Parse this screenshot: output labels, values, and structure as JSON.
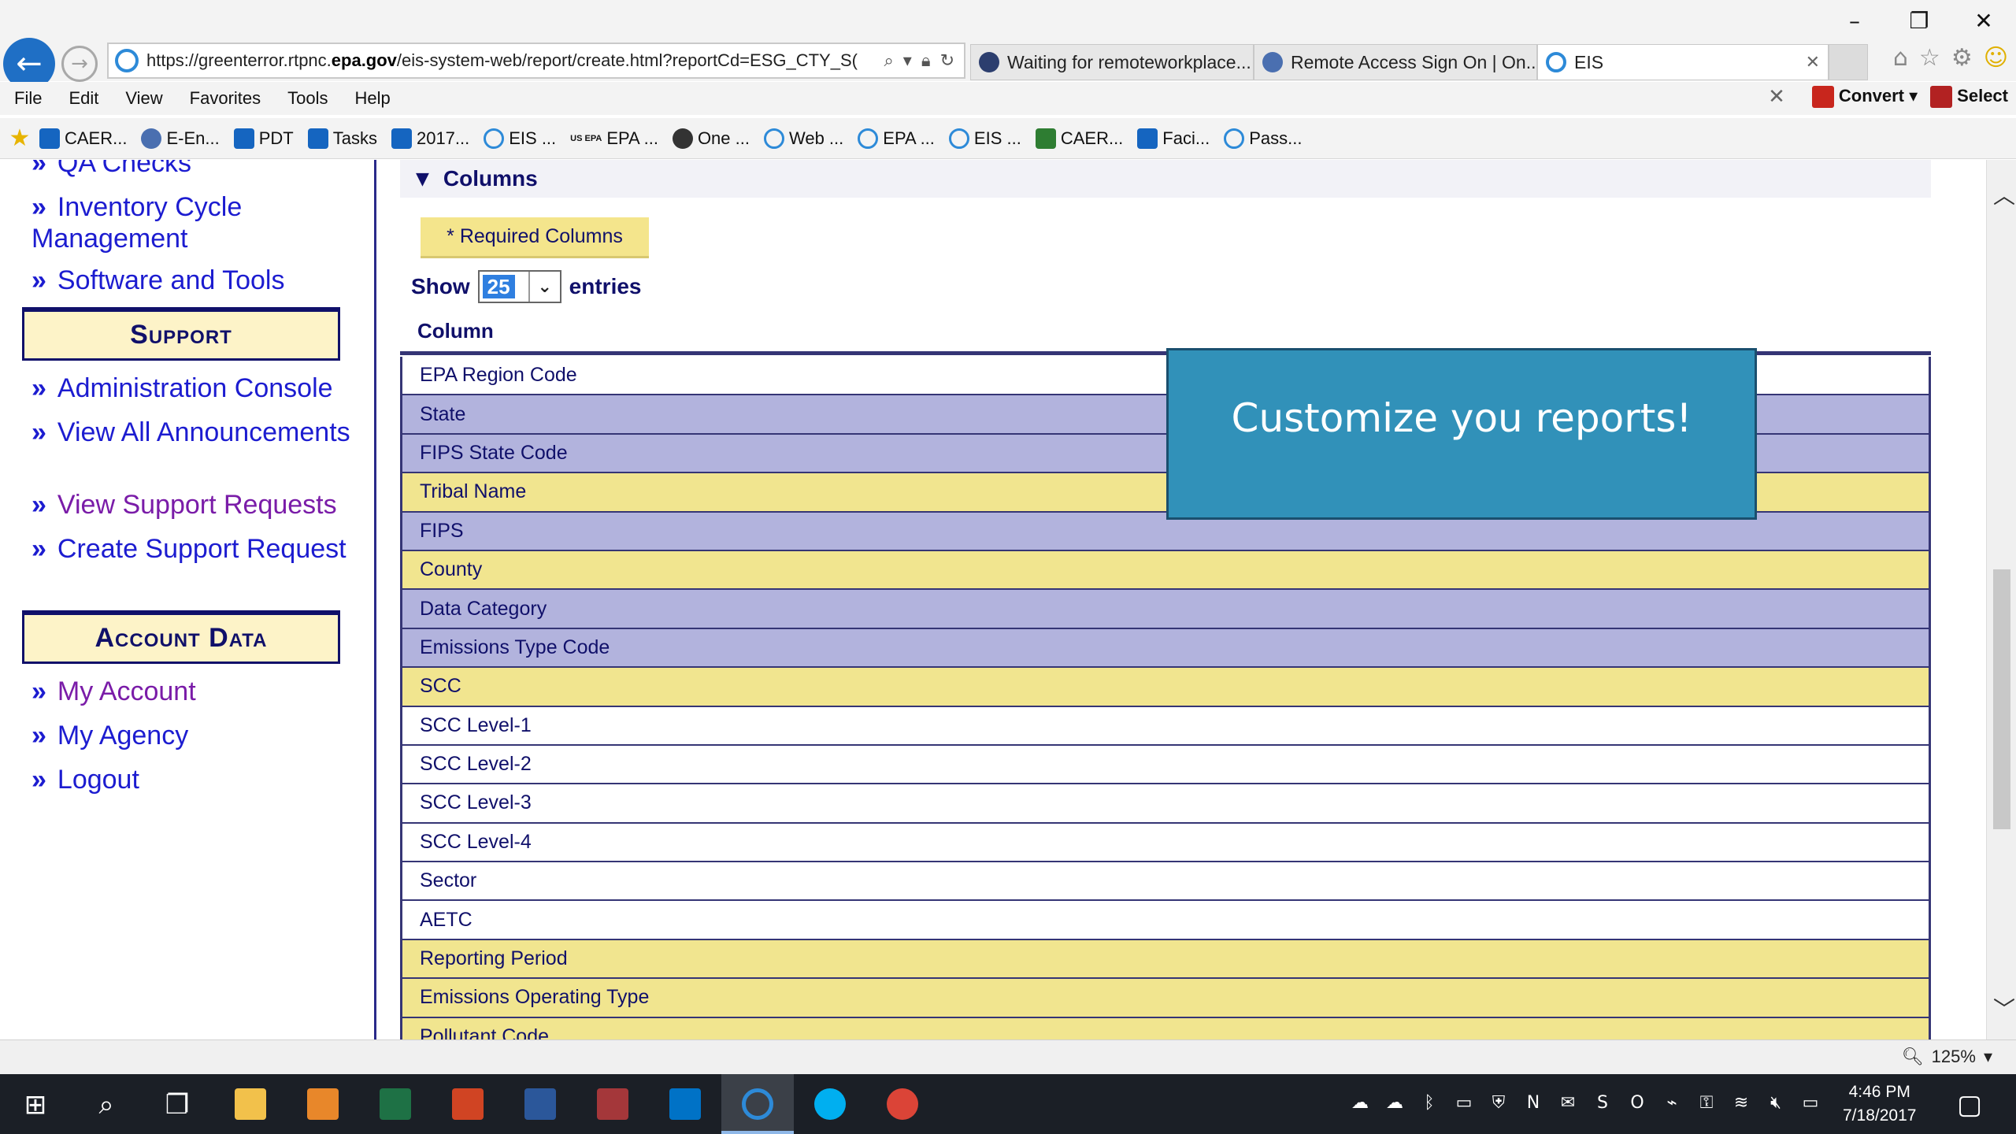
{
  "browser": {
    "url_prefix": "https://greenterror.rtpnc.",
    "url_domain": "epa.gov",
    "url_suffix": "/eis-system-web/report/create.html?reportCd=ESG_CTY_S(",
    "tabs": [
      {
        "title": "Waiting for remoteworkplace..."
      },
      {
        "title": "Remote Access Sign On | On..."
      },
      {
        "title": "EIS"
      }
    ],
    "menu": [
      "File",
      "Edit",
      "View",
      "Favorites",
      "Tools",
      "Help"
    ],
    "convert_label": "Convert",
    "select_label": "Select",
    "favorites": [
      "CAER...",
      "E-En...",
      "PDT",
      "Tasks",
      "2017...",
      "EIS ...",
      "EPA ...",
      "One ...",
      "Web ...",
      "EPA ...",
      "EIS ...",
      "CAER...",
      "Faci...",
      "Pass..."
    ],
    "fav_us_epa": "US EPA",
    "zoom": "125%"
  },
  "sidebar": {
    "partial_top": "QA Checks",
    "link_inventory": "Inventory Cycle Management",
    "link_software": "Software and Tools",
    "support_heading": "Support",
    "link_admin": "Administration Console",
    "link_announcements": "View All Announcements",
    "link_view_support": "View Support Requests",
    "link_create_support": "Create Support Request",
    "account_heading": "Account Data",
    "link_my_account": "My Account",
    "link_my_agency": "My Agency",
    "link_logout": "Logout"
  },
  "main": {
    "section_title": "Columns",
    "required_badge": "* Required Columns",
    "show_label": "Show",
    "show_value": "25",
    "entries_label": "entries",
    "column_header": "Column",
    "rows": [
      {
        "label": "EPA Region Code",
        "style": "white"
      },
      {
        "label": "State",
        "style": "purple"
      },
      {
        "label": "FIPS State Code",
        "style": "purple"
      },
      {
        "label": "Tribal Name",
        "style": "yellow"
      },
      {
        "label": "FIPS",
        "style": "purple"
      },
      {
        "label": "County",
        "style": "yellow"
      },
      {
        "label": "Data Category",
        "style": "purple"
      },
      {
        "label": "Emissions Type Code",
        "style": "purple"
      },
      {
        "label": "SCC",
        "style": "yellow"
      },
      {
        "label": "SCC Level-1",
        "style": "white"
      },
      {
        "label": "SCC Level-2",
        "style": "white"
      },
      {
        "label": "SCC Level-3",
        "style": "white"
      },
      {
        "label": "SCC Level-4",
        "style": "white"
      },
      {
        "label": "Sector",
        "style": "white"
      },
      {
        "label": "AETC",
        "style": "white"
      },
      {
        "label": "Reporting Period",
        "style": "yellow"
      },
      {
        "label": "Emissions Operating Type",
        "style": "yellow"
      },
      {
        "label": "Pollutant Code",
        "style": "yellow"
      }
    ]
  },
  "callout": {
    "text": "Customize you reports!"
  },
  "taskbar": {
    "time": "4:46 PM",
    "date": "7/18/2017"
  },
  "colors": {
    "row_purple": "#b2b3dd",
    "row_yellow": "#f1e58f",
    "link_blue": "#1c1cd0",
    "navy": "#10106a",
    "callout_bg": "#3191b9"
  }
}
